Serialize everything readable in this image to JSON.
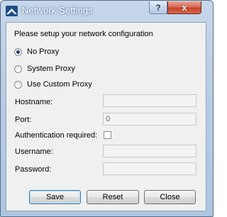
{
  "window": {
    "title": "Network Settings",
    "help_label": "?",
    "close_label": "x"
  },
  "intro_text": "Please setup your network configuration",
  "proxy_options": [
    {
      "label": "No Proxy",
      "selected": true
    },
    {
      "label": "System Proxy",
      "selected": false
    },
    {
      "label": "Use Custom Proxy",
      "selected": false
    }
  ],
  "fields": {
    "hostname": {
      "label": "Hostname:",
      "value": ""
    },
    "port": {
      "label": "Port:",
      "value": "0"
    },
    "auth": {
      "label": "Authentication required:",
      "checked": false
    },
    "username": {
      "label": "Username:",
      "value": ""
    },
    "password": {
      "label": "Password:",
      "value": ""
    }
  },
  "buttons": {
    "save": "Save",
    "reset": "Reset",
    "close": "Close"
  }
}
